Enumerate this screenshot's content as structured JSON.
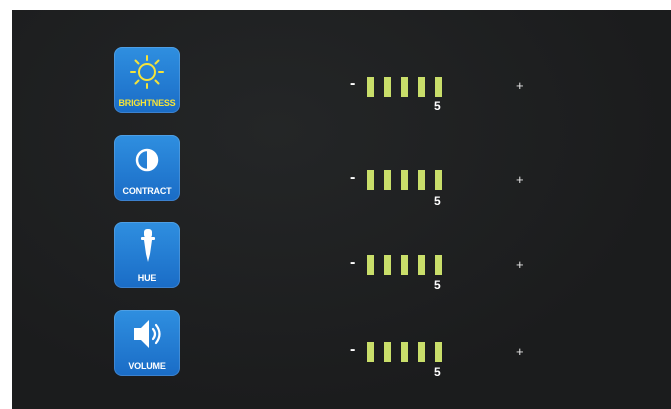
{
  "settings": [
    {
      "id": "brightness",
      "label": "BRIGHTNESS",
      "icon": "sun-icon",
      "minus": "-",
      "plus": "+",
      "value": "5",
      "level": 5,
      "max_level": 5
    },
    {
      "id": "contract",
      "label": "CONTRACT",
      "icon": "contrast-icon",
      "minus": "-",
      "plus": "+",
      "value": "5",
      "level": 5,
      "max_level": 5
    },
    {
      "id": "hue",
      "label": "HUE",
      "icon": "eyedropper-icon",
      "minus": "-",
      "plus": "+",
      "value": "5",
      "level": 5,
      "max_level": 5
    },
    {
      "id": "volume",
      "label": "VOLUME",
      "icon": "speaker-icon",
      "minus": "-",
      "plus": "+",
      "value": "5",
      "level": 5,
      "max_level": 5
    }
  ],
  "colors": {
    "tile": "#1a6cc6",
    "meter_on": "#c9de6a",
    "brightness_label": "#f4e33a",
    "sun": "#f4e33a"
  }
}
